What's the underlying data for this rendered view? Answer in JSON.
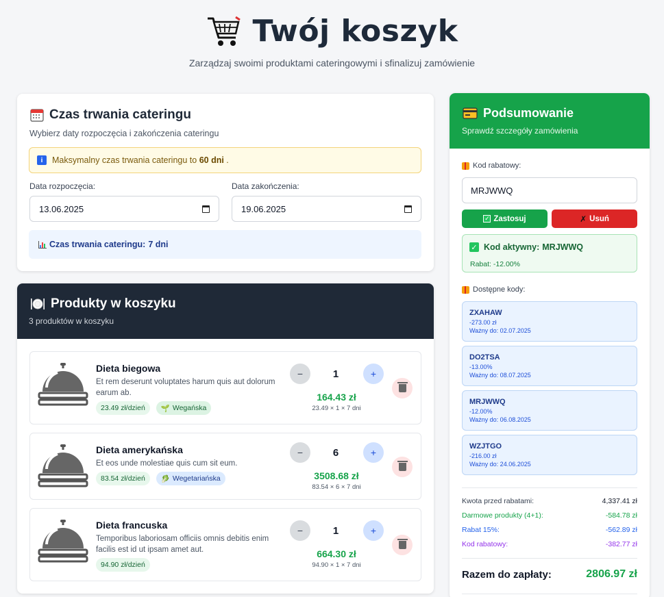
{
  "header": {
    "title": "Twój koszyk",
    "subtitle": "Zarządzaj swoimi produktami cateringowymi i sfinalizuj zamówienie"
  },
  "duration": {
    "title": "Czas trwania cateringu",
    "description": "Wybierz daty rozpoczęcia i zakończenia cateringu",
    "warning_prefix": "Maksymalny czas trwania cateringu to",
    "warning_value": "60 dni",
    "warning_suffix": ".",
    "start_label": "Data rozpoczęcia:",
    "start_value": "13.06.2025",
    "end_label": "Data zakończenia:",
    "end_value": "19.06.2025",
    "info_label": "Czas trwania cateringu:",
    "info_value": "7 dni"
  },
  "products": {
    "title": "Produkty w koszyku",
    "count_text": "3 produktów w koszyku",
    "items": [
      {
        "name": "Dieta biegowa",
        "description": "Et rem deserunt voluptates harum quis aut dolorum earum ab.",
        "price_badge": "23.49 zł/dzień",
        "diet_badge": "Wegańska",
        "quantity": "1",
        "total": "164.43 zł",
        "calc": "23.49 × 1 × 7 dni"
      },
      {
        "name": "Dieta amerykańska",
        "description": "Et eos unde molestiae quis cum sit eum.",
        "price_badge": "83.54 zł/dzień",
        "diet_badge": "Wegetariańska",
        "quantity": "6",
        "total": "3508.68 zł",
        "calc": "83.54 × 6 × 7 dni"
      },
      {
        "name": "Dieta francuska",
        "description": "Temporibus laboriosam officiis omnis debitis enim facilis est id ut ipsam amet aut.",
        "price_badge": "94.90 zł/dzień",
        "quantity": "1",
        "total": "664.30 zł",
        "calc": "94.90 × 1 × 7 dni"
      }
    ],
    "minus_label": "−",
    "plus_label": "+"
  },
  "summary": {
    "title": "Podsumowanie",
    "subtitle": "Sprawdź szczegóły zamówienia",
    "code_label": "Kod rabatowy:",
    "code_value": "MRJWWQ",
    "apply_label": "Zastosuj",
    "remove_label": "Usuń",
    "active_prefix": "Kod aktywny:",
    "active_code": "MRJWWQ",
    "active_discount": "Rabat: -12.00%",
    "available_label": "Dostępne kody:",
    "codes": [
      {
        "name": "ZXAHAW",
        "value": "-273.00 zł",
        "valid": "Ważny do: 02.07.2025"
      },
      {
        "name": "DO2TSA",
        "value": "-13.00%",
        "valid": "Ważny do: 08.07.2025"
      },
      {
        "name": "MRJWWQ",
        "value": "-12.00%",
        "valid": "Ważny do: 06.08.2025"
      },
      {
        "name": "WZJTGO",
        "value": "-216.00 zł",
        "valid": "Ważny do: 24.06.2025"
      }
    ],
    "rows": [
      {
        "label": "Kwota przed rabatami:",
        "value": "4,337.41 zł",
        "color": "#374151"
      },
      {
        "label": "Darmowe produkty (4+1):",
        "value": "-584.78 zł",
        "color": "#16a34a"
      },
      {
        "label": "Rabat 15%:",
        "value": "-562.89 zł",
        "color": "#2563eb"
      },
      {
        "label": "Kod rabatowy:",
        "value": "-382.77 zł",
        "color": "#9333ea"
      }
    ],
    "total_label": "Razem do zapłaty:",
    "total_value": "2806.97 zł"
  },
  "colors": {
    "accent_green": "#16a34a",
    "dark_header": "#1f2937",
    "danger": "#dc2626",
    "info_blue": "#2563eb"
  },
  "icons": {
    "title_icon": "shopping-cart-icon",
    "calendar": "calendar-icon",
    "products": "plate-icon",
    "summary": "card-icon",
    "product_image": "cloche-icon"
  }
}
